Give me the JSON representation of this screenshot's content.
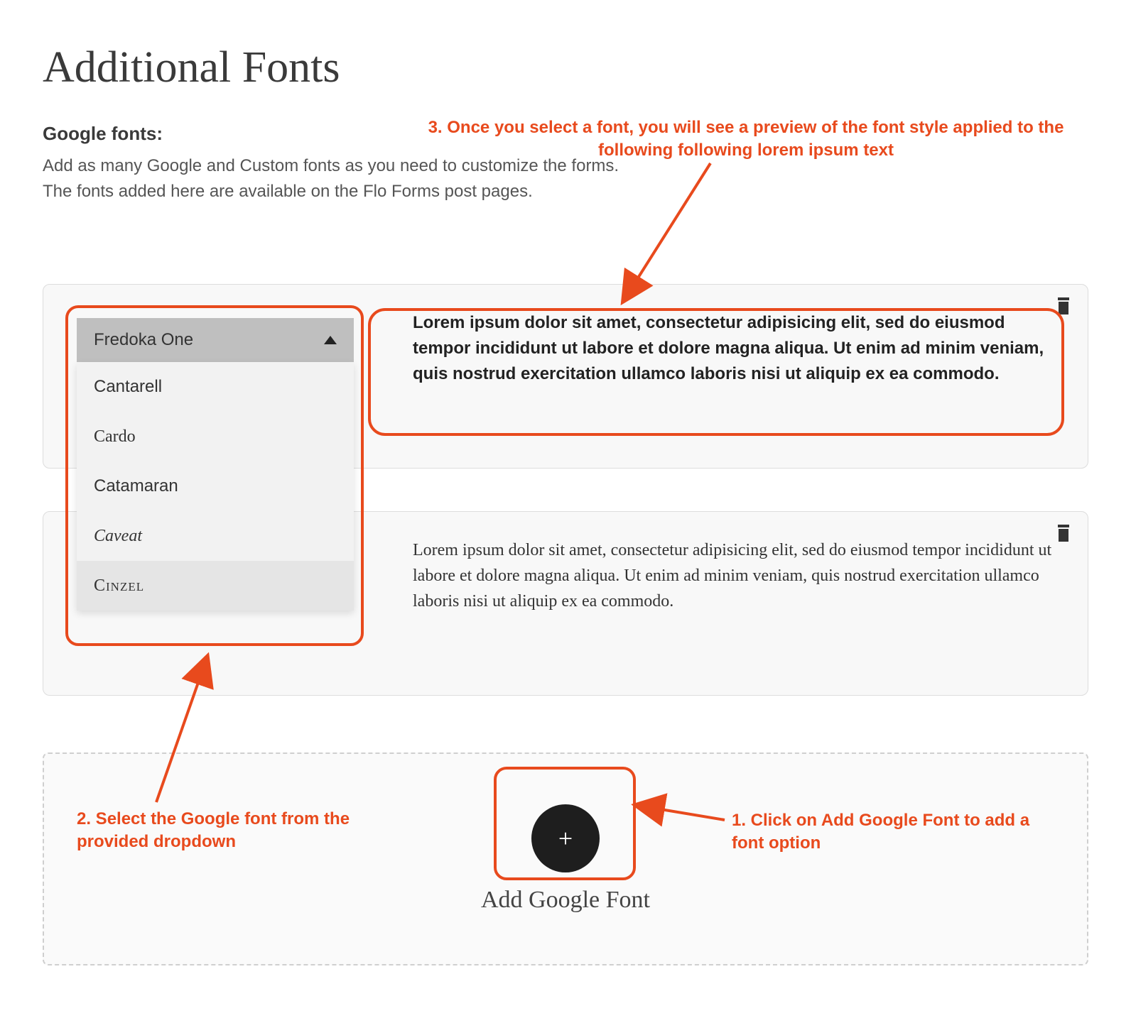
{
  "page_title": "Additional Fonts",
  "section_label": "Google fonts:",
  "section_desc_line1": "Add as many Google and Custom fonts as you need to customize the forms.",
  "section_desc_line2": "The fonts added here are available on the Flo Forms post pages.",
  "dropdown": {
    "selected": "Fredoka One",
    "options": [
      "Cantarell",
      "Cardo",
      "Catamaran",
      "Caveat",
      "Cinzel"
    ]
  },
  "preview_text": "Lorem ipsum dolor sit amet, consectetur adipisicing elit, sed do eiusmod tempor incididunt ut labore et dolore magna aliqua. Ut enim ad minim veniam, quis nostrud exercitation ullamco laboris nisi ut aliquip ex ea commodo.",
  "add_button_label": "Add Google Font",
  "annotations": {
    "step1": "1. Click on Add Google Font to add a font option",
    "step2": "2. Select the Google font from the provided dropdown",
    "step3": "3. Once you select a font, you will see a preview of the font style applied to the following following lorem ipsum text"
  }
}
